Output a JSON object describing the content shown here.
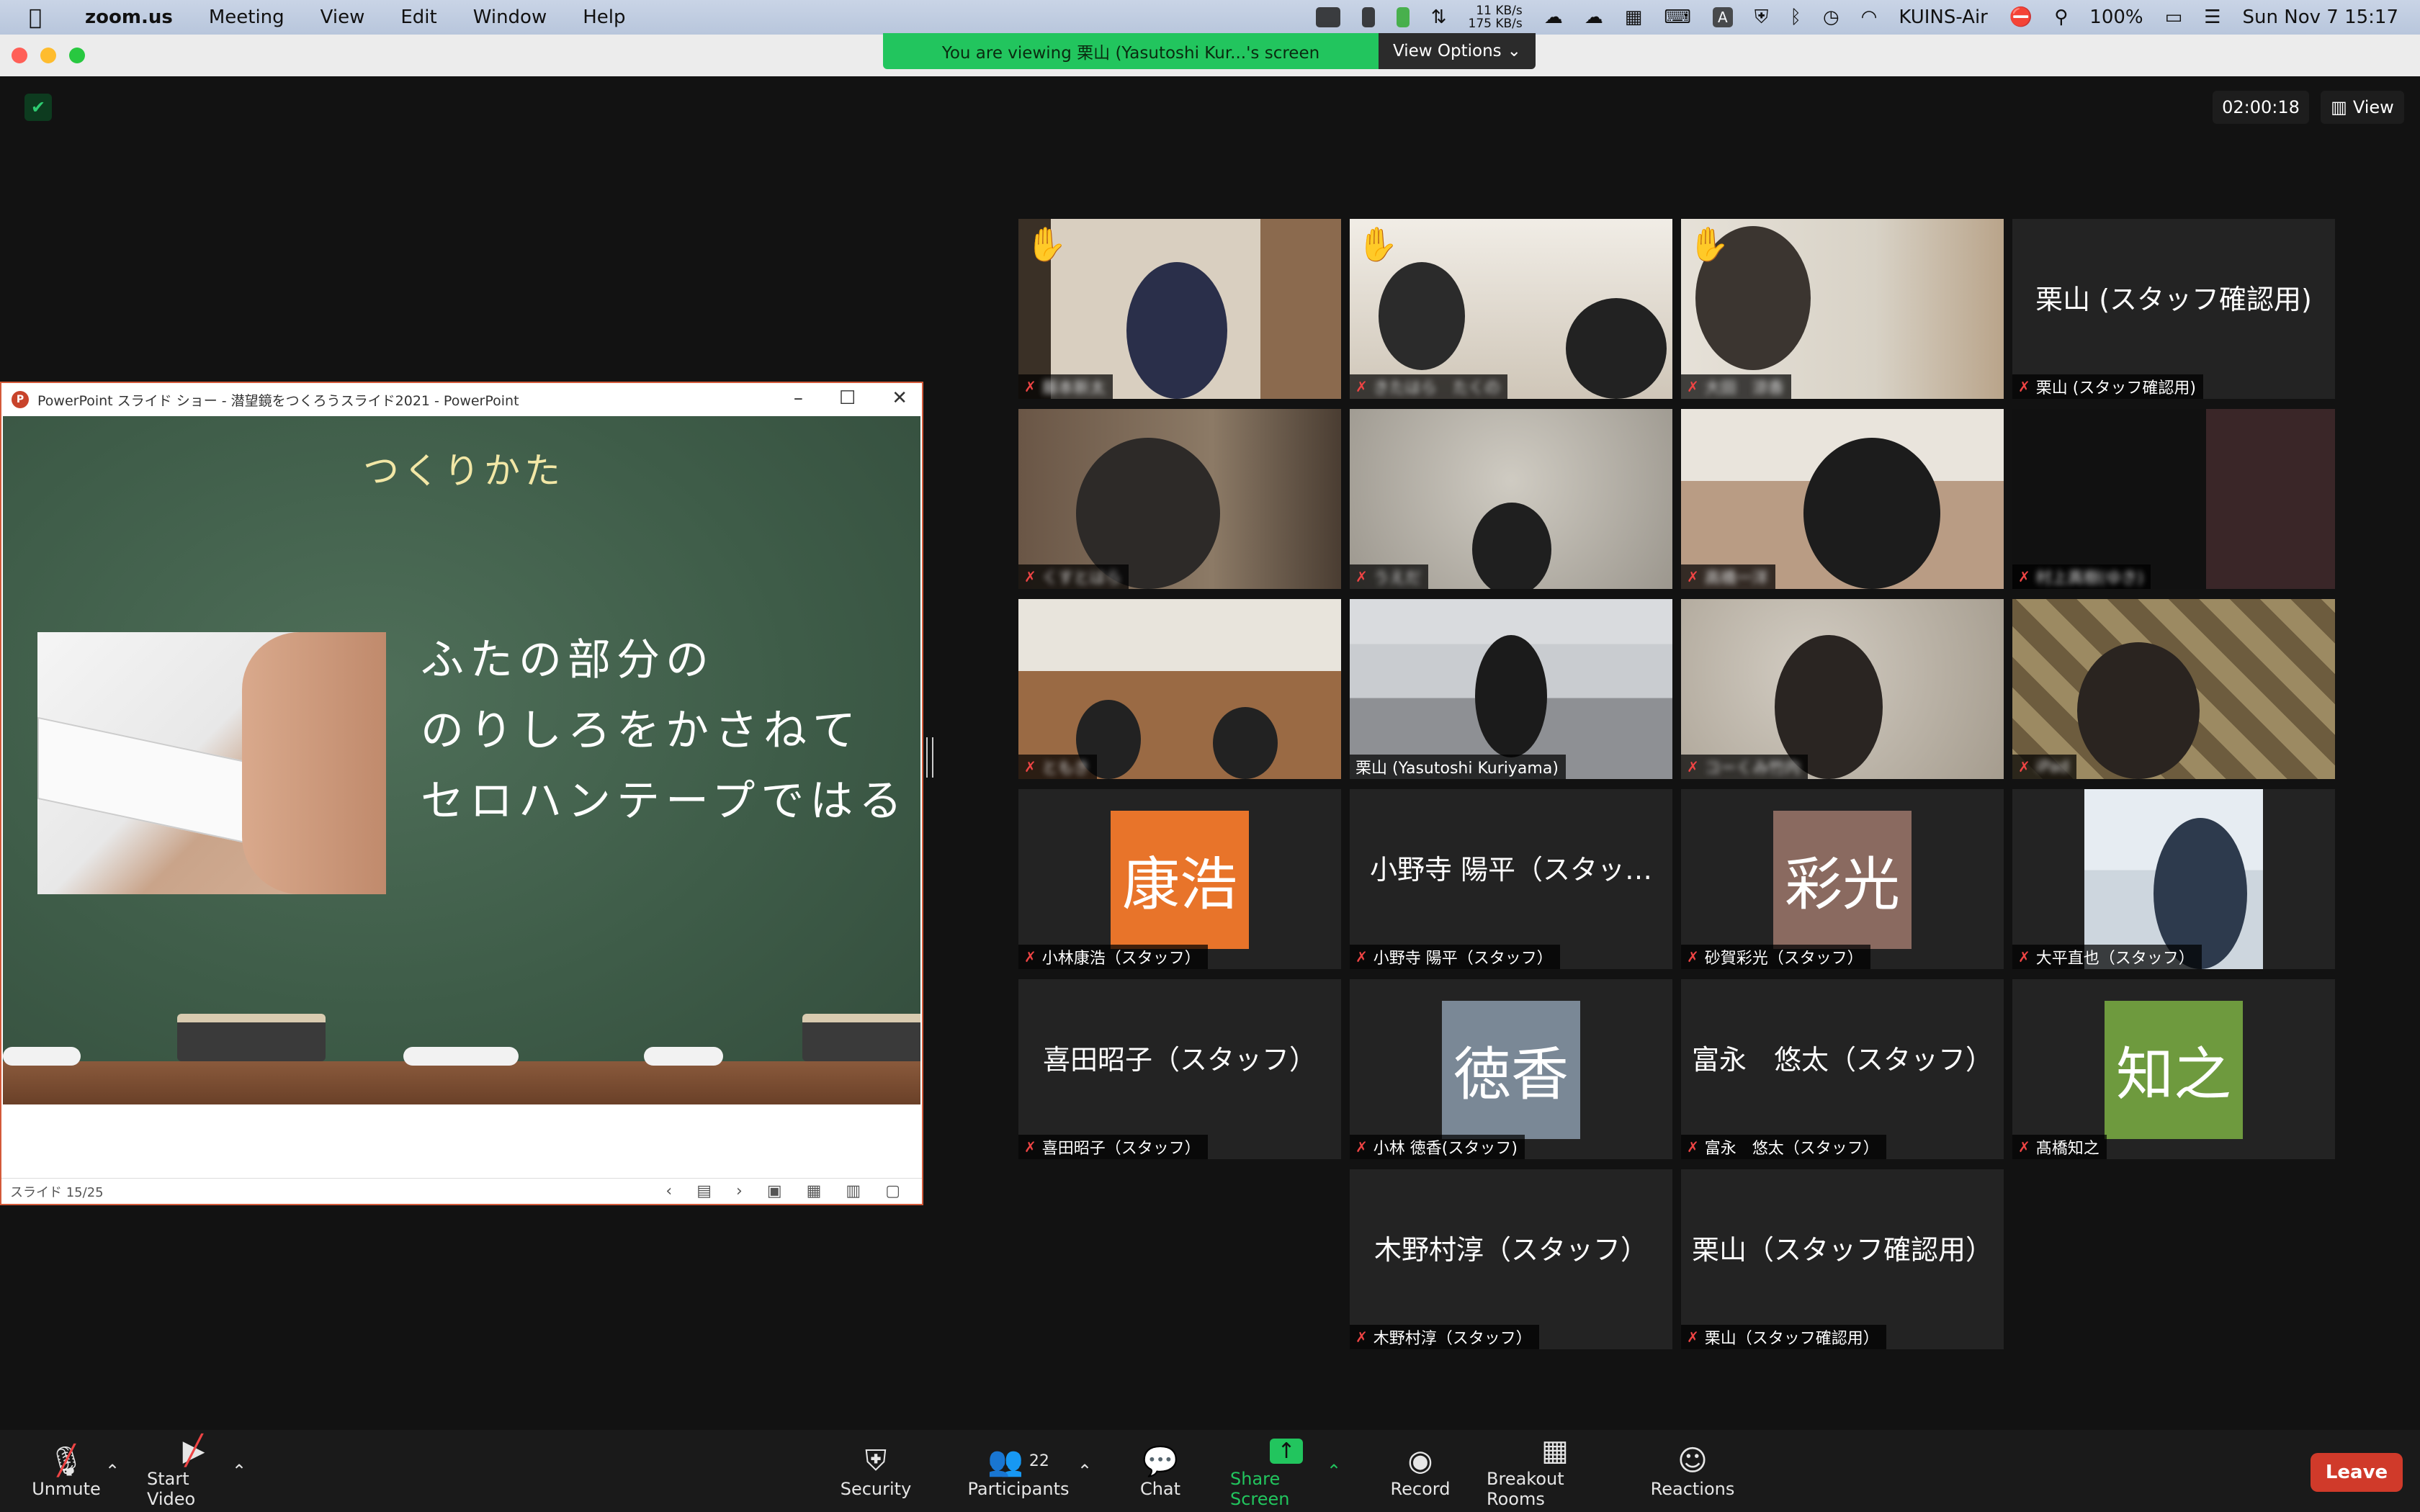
{
  "menubar": {
    "app": "zoom.us",
    "items": [
      "Meeting",
      "View",
      "Edit",
      "Window",
      "Help"
    ],
    "net_up": "11 KB/s",
    "net_down": "175 KB/s",
    "host": "KUINS-Air",
    "battery": "100%",
    "datetime": "Sun Nov 7  15:17"
  },
  "banner": {
    "message": "You are viewing 栗山 (Yasutoshi Kur...'s screen",
    "options": "View Options"
  },
  "meeting": {
    "timer": "02:00:18",
    "view_label": "View"
  },
  "ppt": {
    "title": "PowerPoint スライド ショー  -  潜望鏡をつくろうスライド2021  -  PowerPoint",
    "slide_heading": "つくりかた",
    "slide_lines": [
      "ふたの部分の",
      "のりしろをかさねて",
      "セロハンテープではる"
    ],
    "status": "スライド 15/25"
  },
  "gallery": [
    {
      "name": "藤本新太",
      "blurred": true,
      "hand": true,
      "muted": true
    },
    {
      "name": "きたはら　たくの",
      "blurred": true,
      "hand": true,
      "muted": true
    },
    {
      "name": "大田　涼香",
      "blurred": true,
      "hand": true,
      "muted": true
    },
    {
      "name": "栗山 (スタッフ確認用)",
      "center": "栗山 (スタッフ確認用)",
      "muted": true
    },
    {
      "name": "くすとはら",
      "blurred": true,
      "muted": true
    },
    {
      "name": "うえだ",
      "blurred": true,
      "muted": true
    },
    {
      "name": "高橋一洋",
      "blurred": true,
      "muted": true
    },
    {
      "name": "村上真樹(ゆき)",
      "blurred": true,
      "muted": true
    },
    {
      "name": "ともき",
      "blurred": true,
      "muted": true
    },
    {
      "name": "栗山 (Yasutoshi Kuriyama)",
      "active": true,
      "muted": false
    },
    {
      "name": "コーくみ竹内",
      "blurred": true,
      "muted": true
    },
    {
      "name": "iPad",
      "blurred": true,
      "muted": true
    },
    {
      "name": "小林康浩（スタッフ）",
      "avatar": "康浩",
      "muted": true
    },
    {
      "name": "小野寺 陽平（スタッフ）",
      "center": "小野寺 陽平（スタッ…",
      "muted": true
    },
    {
      "name": "砂賀彩光（スタッフ）",
      "avatar": "彩光",
      "muted": true
    },
    {
      "name": "大平直也（スタッフ）",
      "muted": true
    },
    {
      "name": "喜田昭子（スタッフ）",
      "center": "喜田昭子（スタッフ）",
      "muted": true
    },
    {
      "name": "小林 徳香(スタッフ)",
      "avatar": "徳香",
      "muted": true
    },
    {
      "name": "富永　悠太（スタッフ）",
      "center": "富永　悠太（スタッフ）",
      "muted": true
    },
    {
      "name": "髙橋知之",
      "avatar": "知之",
      "muted": true
    },
    {
      "name": "木野村淳（スタッフ）",
      "center": "木野村淳（スタッフ）",
      "muted": true
    },
    {
      "name": "栗山（スタッフ確認用）",
      "center": "栗山（スタッフ確認用）",
      "muted": true
    }
  ],
  "colors": {
    "avatar_康浩": "#e8742a",
    "avatar_彩光": "#8a6a60",
    "avatar_徳香": "#7a8896",
    "avatar_知之": "#6e9a3e",
    "share_green": "#22c55e",
    "leave_red": "#d03a2a"
  },
  "toolbar": {
    "unmute": "Unmute",
    "start_video": "Start Video",
    "security": "Security",
    "participants": "Participants",
    "participants_count": "22",
    "chat": "Chat",
    "share_screen": "Share Screen",
    "record": "Record",
    "breakout": "Breakout Rooms",
    "reactions": "Reactions",
    "leave": "Leave"
  }
}
